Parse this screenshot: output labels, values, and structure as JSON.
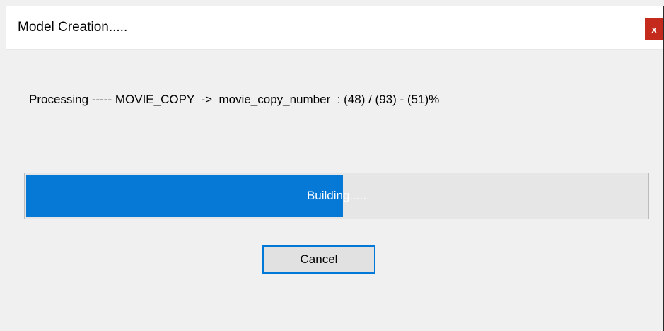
{
  "window": {
    "title": "Model Creation.....",
    "close_label": "x"
  },
  "status_text": "Processing ----- MOVIE_COPY  ->  movie_copy_number  : (48) / (93) - (51)%",
  "progress": {
    "label": "Building.....",
    "percent": 51,
    "fill_color": "#0679d7"
  },
  "buttons": {
    "cancel_label": "Cancel"
  }
}
